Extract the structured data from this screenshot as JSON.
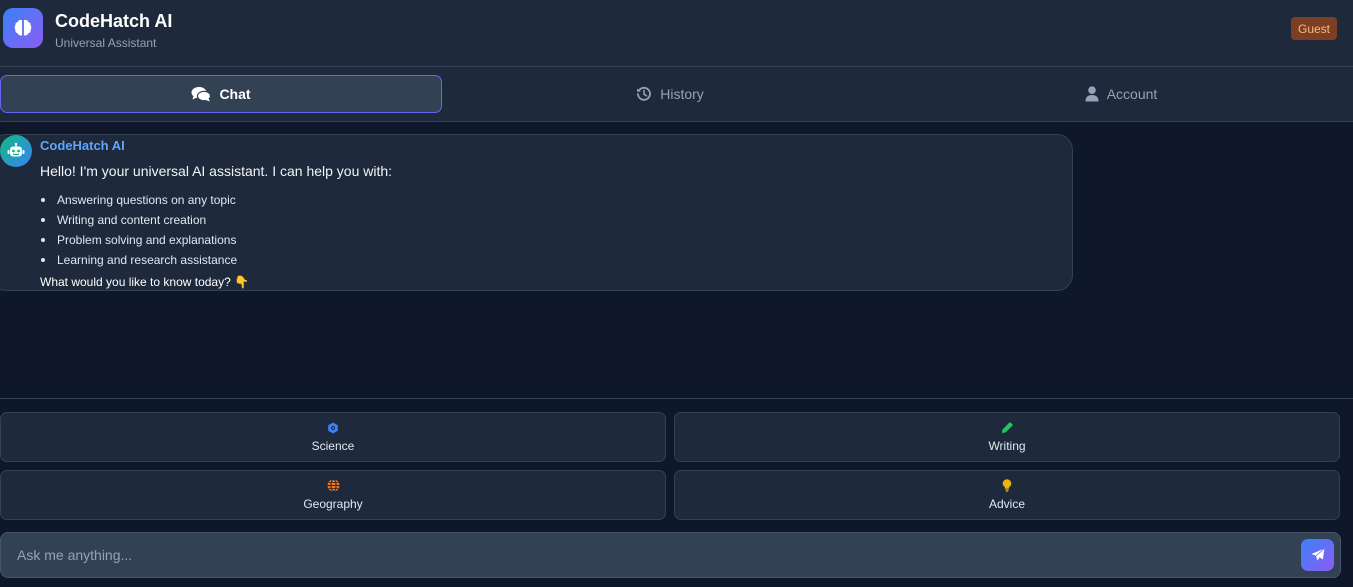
{
  "header": {
    "title": "CodeHatch AI",
    "subtitle": "Universal Assistant",
    "badge": "Guest",
    "logo_icon": "brain-icon"
  },
  "tabs": [
    {
      "label": "Chat",
      "icon": "comments-icon",
      "active": true
    },
    {
      "label": "History",
      "icon": "history-icon",
      "active": false
    },
    {
      "label": "Account",
      "icon": "user-icon",
      "active": false
    }
  ],
  "message": {
    "sender": "CodeHatch AI",
    "avatar_icon": "robot-icon",
    "intro": "Hello! I'm your universal AI assistant. I can help you with:",
    "items": [
      "Answering questions on any topic",
      "Writing and content creation",
      "Problem solving and explanations",
      "Learning and research assistance"
    ],
    "outro": "What would you like to know today? 👇"
  },
  "quick_actions": [
    {
      "label": "Science",
      "icon": "atom-icon",
      "color": "#3b82f6"
    },
    {
      "label": "Writing",
      "icon": "pencil-icon",
      "color": "#22c55e"
    },
    {
      "label": "Geography",
      "icon": "globe-icon",
      "color": "#f97316"
    },
    {
      "label": "Advice",
      "icon": "lightbulb-icon",
      "color": "#eab308"
    }
  ],
  "input": {
    "placeholder": "Ask me anything...",
    "value": ""
  },
  "colors": {
    "accent": "#6366f1",
    "badge_bg": "#7c3f24",
    "badge_text": "#fdba74",
    "bot_name": "#60a5fa"
  }
}
